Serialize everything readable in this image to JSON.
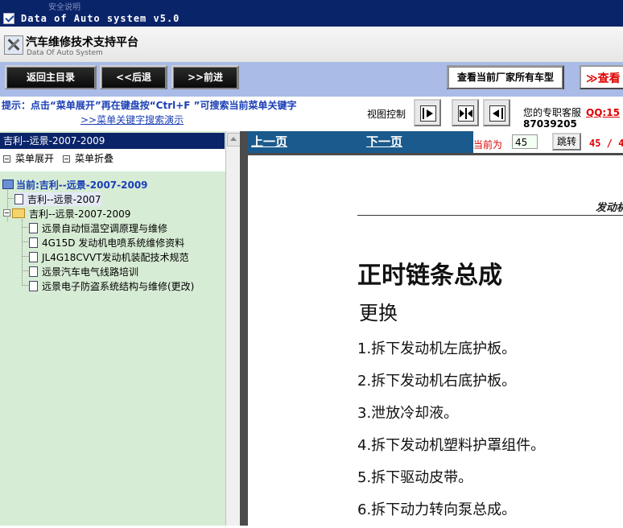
{
  "window": {
    "ghost_text": "安全说明",
    "title": "Data of Auto system v5.0"
  },
  "header": {
    "title": "汽车维修技术支持平台",
    "subtitle": "Data Of Auto System"
  },
  "toolbar": {
    "home": "返回主目录",
    "back": "<<后退",
    "forward": ">>前进",
    "all_models": "查看当前厂家所有车型",
    "view_more": "≫查看"
  },
  "hint": {
    "text": "提示：点击“菜单展开”再在键盘按“Ctrl+F ”可搜索当前菜单关键字",
    "demo_link": ">>菜单关键字搜索演示"
  },
  "view_control": {
    "label": "视图控制"
  },
  "service": {
    "label": "您的专职客服",
    "qq": "QQ:15",
    "number": "87039205"
  },
  "left": {
    "selected": "吉利--远景-2007-2009",
    "expand": "菜单展开",
    "collapse": "菜单折叠",
    "tree": {
      "current": "当前:吉利--远景-2007-2009",
      "item1": "吉利--远景-2007",
      "folder": "吉利--远景-2007-2009",
      "children": [
        "远景自动恒温空调原理与维修",
        "4G15D 发动机电喷系统维修资料",
        "JL4G18CVVT发动机装配技术规范",
        "远景汽车电气线路培训",
        "远景电子防盗系统结构与维修(更改)"
      ]
    }
  },
  "nav": {
    "prev": "上一页",
    "next": "下一页",
    "current_label": "当前为",
    "page": "45",
    "go": "跳转",
    "count": "45 / 4"
  },
  "doc": {
    "header": "发动机",
    "title": "正时链条总成",
    "subtitle": "更换",
    "steps": [
      "1.拆下发动机左底护板。",
      "2.拆下发动机右底护板。",
      "3.泄放冷却液。",
      "4.拆下发动机塑料护罩组件。",
      "5.拆下驱动皮带。",
      "6.拆下动力转向泵总成。"
    ]
  },
  "colors": {
    "title_bar": "#0a246a",
    "toolbar": "#a9bbe6",
    "left_panel": "#d7ecd5",
    "nav_bar": "#1b5a8c",
    "accent_red": "#e00000",
    "hint_blue": "#1a3fb4"
  }
}
